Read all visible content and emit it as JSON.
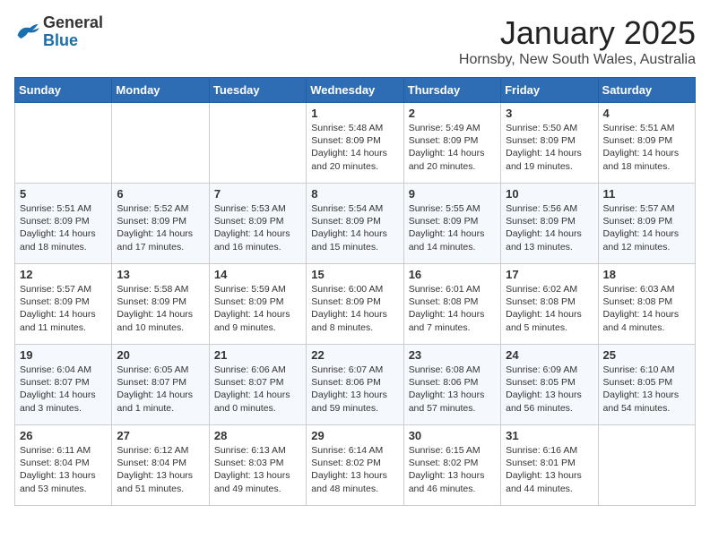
{
  "logo": {
    "general": "General",
    "blue": "Blue"
  },
  "header": {
    "month_year": "January 2025",
    "location": "Hornsby, New South Wales, Australia"
  },
  "days_of_week": [
    "Sunday",
    "Monday",
    "Tuesday",
    "Wednesday",
    "Thursday",
    "Friday",
    "Saturday"
  ],
  "weeks": [
    [
      {
        "day": "",
        "info": ""
      },
      {
        "day": "",
        "info": ""
      },
      {
        "day": "",
        "info": ""
      },
      {
        "day": "1",
        "info": "Sunrise: 5:48 AM\nSunset: 8:09 PM\nDaylight: 14 hours\nand 20 minutes."
      },
      {
        "day": "2",
        "info": "Sunrise: 5:49 AM\nSunset: 8:09 PM\nDaylight: 14 hours\nand 20 minutes."
      },
      {
        "day": "3",
        "info": "Sunrise: 5:50 AM\nSunset: 8:09 PM\nDaylight: 14 hours\nand 19 minutes."
      },
      {
        "day": "4",
        "info": "Sunrise: 5:51 AM\nSunset: 8:09 PM\nDaylight: 14 hours\nand 18 minutes."
      }
    ],
    [
      {
        "day": "5",
        "info": "Sunrise: 5:51 AM\nSunset: 8:09 PM\nDaylight: 14 hours\nand 18 minutes."
      },
      {
        "day": "6",
        "info": "Sunrise: 5:52 AM\nSunset: 8:09 PM\nDaylight: 14 hours\nand 17 minutes."
      },
      {
        "day": "7",
        "info": "Sunrise: 5:53 AM\nSunset: 8:09 PM\nDaylight: 14 hours\nand 16 minutes."
      },
      {
        "day": "8",
        "info": "Sunrise: 5:54 AM\nSunset: 8:09 PM\nDaylight: 14 hours\nand 15 minutes."
      },
      {
        "day": "9",
        "info": "Sunrise: 5:55 AM\nSunset: 8:09 PM\nDaylight: 14 hours\nand 14 minutes."
      },
      {
        "day": "10",
        "info": "Sunrise: 5:56 AM\nSunset: 8:09 PM\nDaylight: 14 hours\nand 13 minutes."
      },
      {
        "day": "11",
        "info": "Sunrise: 5:57 AM\nSunset: 8:09 PM\nDaylight: 14 hours\nand 12 minutes."
      }
    ],
    [
      {
        "day": "12",
        "info": "Sunrise: 5:57 AM\nSunset: 8:09 PM\nDaylight: 14 hours\nand 11 minutes."
      },
      {
        "day": "13",
        "info": "Sunrise: 5:58 AM\nSunset: 8:09 PM\nDaylight: 14 hours\nand 10 minutes."
      },
      {
        "day": "14",
        "info": "Sunrise: 5:59 AM\nSunset: 8:09 PM\nDaylight: 14 hours\nand 9 minutes."
      },
      {
        "day": "15",
        "info": "Sunrise: 6:00 AM\nSunset: 8:09 PM\nDaylight: 14 hours\nand 8 minutes."
      },
      {
        "day": "16",
        "info": "Sunrise: 6:01 AM\nSunset: 8:08 PM\nDaylight: 14 hours\nand 7 minutes."
      },
      {
        "day": "17",
        "info": "Sunrise: 6:02 AM\nSunset: 8:08 PM\nDaylight: 14 hours\nand 5 minutes."
      },
      {
        "day": "18",
        "info": "Sunrise: 6:03 AM\nSunset: 8:08 PM\nDaylight: 14 hours\nand 4 minutes."
      }
    ],
    [
      {
        "day": "19",
        "info": "Sunrise: 6:04 AM\nSunset: 8:07 PM\nDaylight: 14 hours\nand 3 minutes."
      },
      {
        "day": "20",
        "info": "Sunrise: 6:05 AM\nSunset: 8:07 PM\nDaylight: 14 hours\nand 1 minute."
      },
      {
        "day": "21",
        "info": "Sunrise: 6:06 AM\nSunset: 8:07 PM\nDaylight: 14 hours\nand 0 minutes."
      },
      {
        "day": "22",
        "info": "Sunrise: 6:07 AM\nSunset: 8:06 PM\nDaylight: 13 hours\nand 59 minutes."
      },
      {
        "day": "23",
        "info": "Sunrise: 6:08 AM\nSunset: 8:06 PM\nDaylight: 13 hours\nand 57 minutes."
      },
      {
        "day": "24",
        "info": "Sunrise: 6:09 AM\nSunset: 8:05 PM\nDaylight: 13 hours\nand 56 minutes."
      },
      {
        "day": "25",
        "info": "Sunrise: 6:10 AM\nSunset: 8:05 PM\nDaylight: 13 hours\nand 54 minutes."
      }
    ],
    [
      {
        "day": "26",
        "info": "Sunrise: 6:11 AM\nSunset: 8:04 PM\nDaylight: 13 hours\nand 53 minutes."
      },
      {
        "day": "27",
        "info": "Sunrise: 6:12 AM\nSunset: 8:04 PM\nDaylight: 13 hours\nand 51 minutes."
      },
      {
        "day": "28",
        "info": "Sunrise: 6:13 AM\nSunset: 8:03 PM\nDaylight: 13 hours\nand 49 minutes."
      },
      {
        "day": "29",
        "info": "Sunrise: 6:14 AM\nSunset: 8:02 PM\nDaylight: 13 hours\nand 48 minutes."
      },
      {
        "day": "30",
        "info": "Sunrise: 6:15 AM\nSunset: 8:02 PM\nDaylight: 13 hours\nand 46 minutes."
      },
      {
        "day": "31",
        "info": "Sunrise: 6:16 AM\nSunset: 8:01 PM\nDaylight: 13 hours\nand 44 minutes."
      },
      {
        "day": "",
        "info": ""
      }
    ]
  ]
}
